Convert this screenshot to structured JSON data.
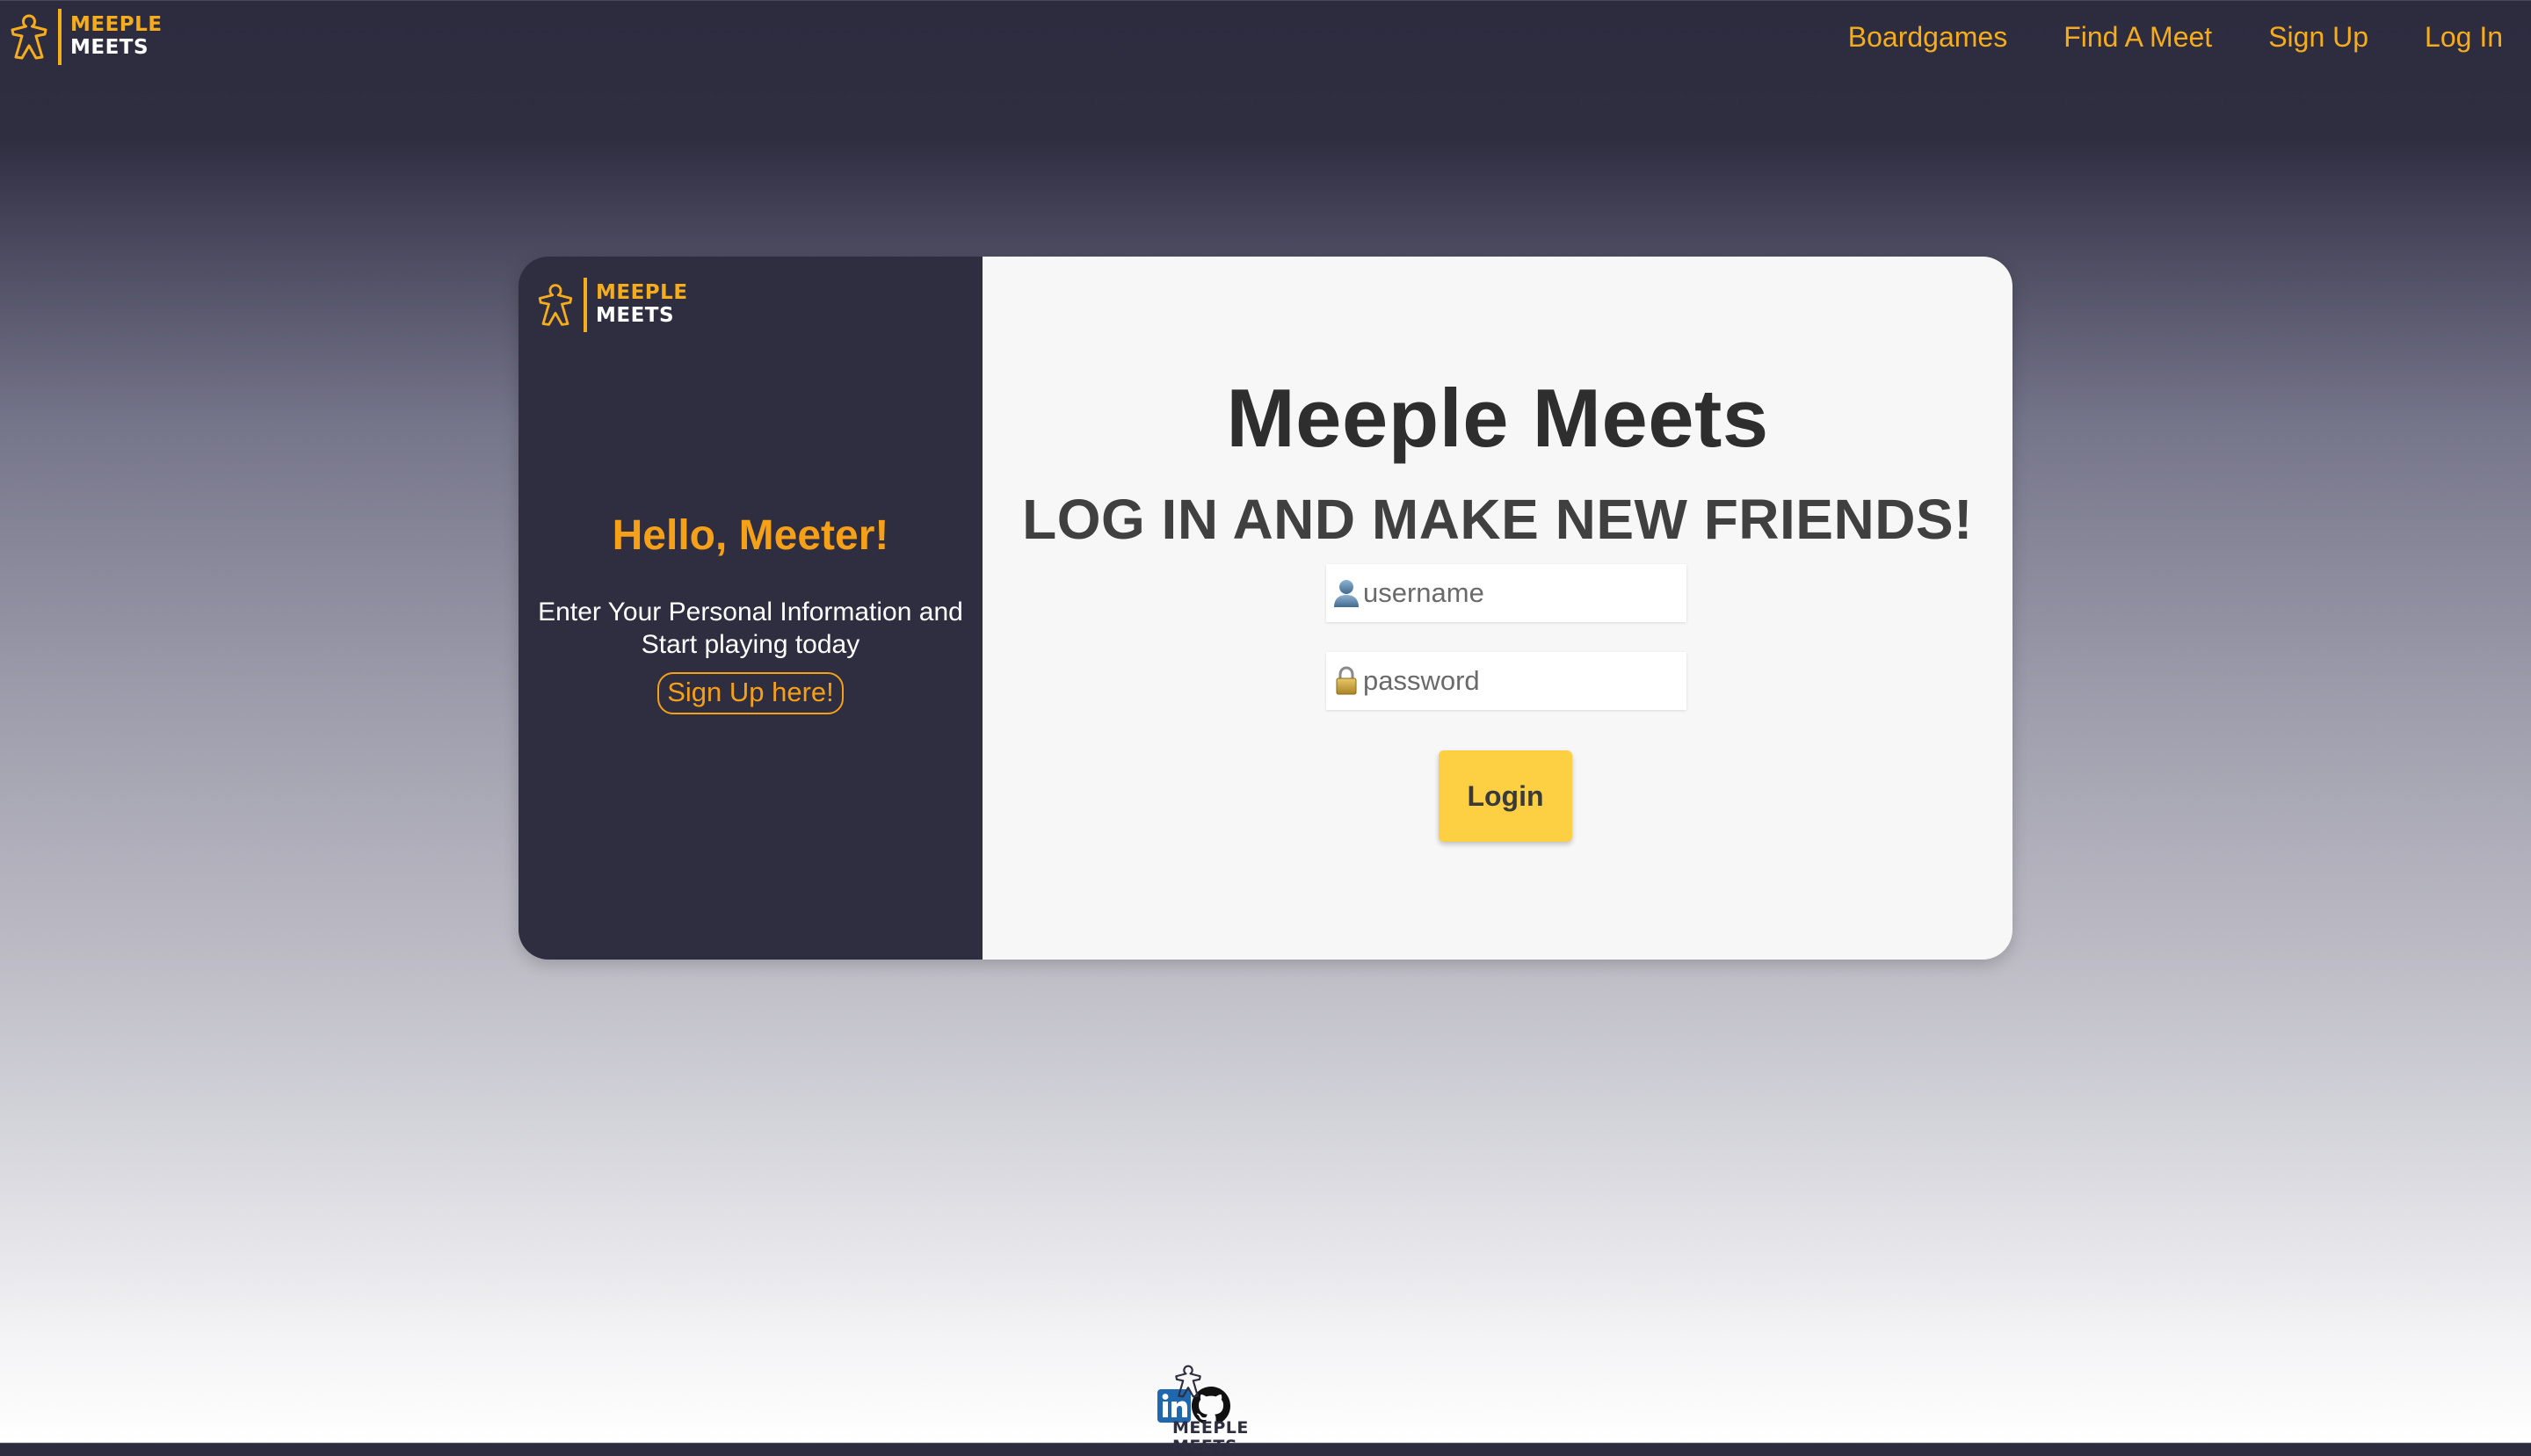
{
  "brand": {
    "line1": "MEEPLE",
    "line2": "MEETS"
  },
  "nav": {
    "links": [
      "Boardgames",
      "Find A Meet",
      "Sign Up",
      "Log In"
    ]
  },
  "left_panel": {
    "greeting": "Hello, Meeter!",
    "subtitle": "Enter Your Personal Information and Start playing today",
    "signup_link": "Sign Up here!"
  },
  "login": {
    "title": "Meeple Meets",
    "subtitle": "LOG IN AND MAKE NEW FRIENDS!",
    "username_placeholder": "username",
    "password_placeholder": "password",
    "button_label": "Login"
  },
  "colors": {
    "accent": "#f5ad1b",
    "panel_dark": "#2f2e41",
    "login_button": "#fdd044"
  },
  "footer": {
    "icons": [
      "linkedin-icon",
      "meeple-meets-logo",
      "github-icon"
    ]
  }
}
